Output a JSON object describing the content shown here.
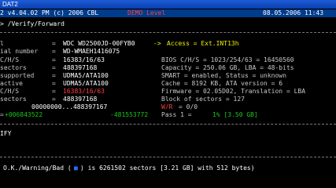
{
  "window": {
    "title": "DAT2"
  },
  "header": {
    "version": "2 v4.04.02 PM (c) 2006 CBL",
    "demo": "DEMO Level",
    "date": "08.05.2006 11:43"
  },
  "path": "> /Verify/Forward",
  "drive": {
    "label_id": "l",
    "model": "WDC WD2500JD-00FYB0",
    "access_arrow": "->",
    "access": "Access = Ext.INT13h",
    "serial_label": "ial number",
    "serial": "WD-WMAEH1416075",
    "chs_label": "C/H/S",
    "chs": "16383/16/63",
    "sectors_label": "sectors",
    "sectors": "488397168",
    "supported_label": "supported",
    "supported": "UDMA5/ATA100",
    "active_label": "active",
    "active": "UDMA5/ATA100",
    "chs2_label": "C/H/S",
    "chs2": "16383/16/63",
    "sectors2_label": "sectors",
    "sectors2": "488397168",
    "range": "00000000...488397167",
    "pos_start": "+006843522",
    "pos_end": "-481553772"
  },
  "right_info": {
    "bios": "BIOS C/H/S = 1023/254/63 = 16450560",
    "capacity": "Capacity = 250.06 GB, LBA = 48-bits",
    "smart": "SMART = enabled, Status = unknown",
    "cache": "Cache = 8192 KB, ATA version = 6",
    "firmware": "Firmware = 02.05D02, Translation = LBA",
    "block": "Block of sectors = 127",
    "wr_label": "W/R",
    "wr_value": "= 0/0",
    "pass_label": "Pass 1 =",
    "pass_value": "1% [3.50 GB]"
  },
  "mode": "IFY",
  "footer": {
    "legend": "O.K./Warning/Bad (",
    "bad_marker": "■",
    "text": ") is 6261502 sectors [3.21 GB] with 512 bytes)"
  }
}
